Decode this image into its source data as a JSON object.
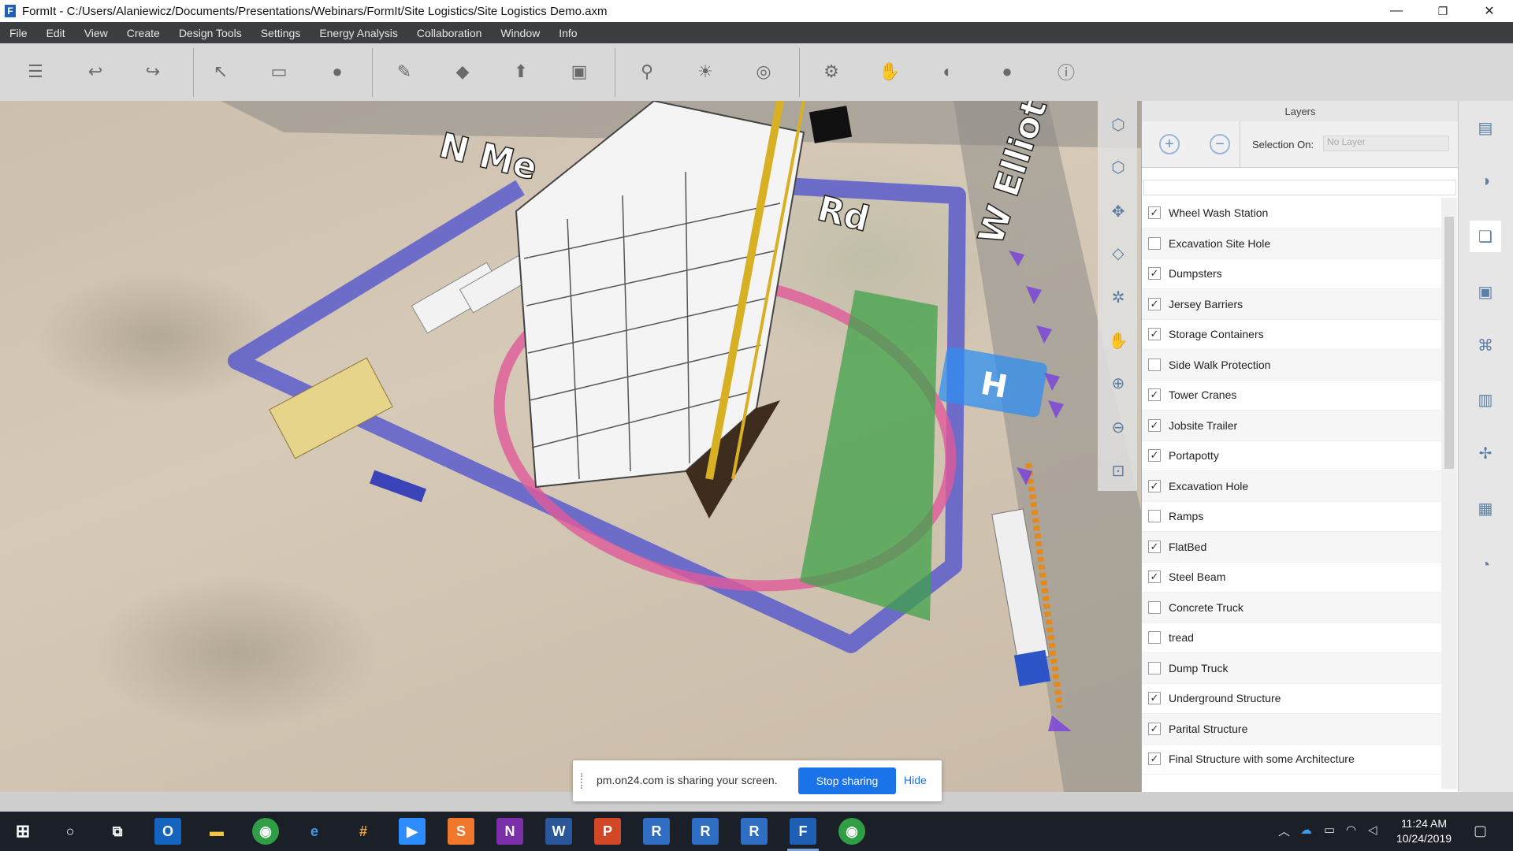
{
  "window": {
    "title": "FormIt - C:/Users/Alaniewicz/Documents/Presentations/Webinars/FormIt/Site Logistics/Site Logistics Demo.axm",
    "app_icon_letter": "F",
    "controls": {
      "minimize": "—",
      "restore": "❐",
      "close": "✕"
    }
  },
  "menu": [
    "File",
    "Edit",
    "View",
    "Create",
    "Design Tools",
    "Settings",
    "Energy Analysis",
    "Collaboration",
    "Window",
    "Info"
  ],
  "toolbar_icons": [
    "layers-menu-icon",
    "undo-icon",
    "redo-icon",
    "select-icon",
    "tape-measure-icon",
    "paint-icon",
    "pencil-icon",
    "cube-icon",
    "extrude-icon",
    "group-icon",
    "location-pin-icon",
    "sun-icon",
    "view-count-icon",
    "settings-gear-icon",
    "hand-icon",
    "share-icon",
    "user-icon",
    "info-icon"
  ],
  "viewport": {
    "road_labels": [
      "N Me",
      "Rd",
      "W Elliot Rd"
    ],
    "helipad_letter": "H"
  },
  "layers_panel": {
    "title": "Layers",
    "selection_label": "Selection On:",
    "selection_value": "No Layer",
    "add_symbol": "+",
    "remove_symbol": "−",
    "items": [
      {
        "name": "Wheel Wash Station",
        "checked": true
      },
      {
        "name": "Excavation Site Hole",
        "checked": false
      },
      {
        "name": "Dumpsters",
        "checked": true
      },
      {
        "name": "Jersey Barriers",
        "checked": true
      },
      {
        "name": "Storage Containers",
        "checked": true
      },
      {
        "name": "Side Walk Protection",
        "checked": false
      },
      {
        "name": "Tower Cranes",
        "checked": true
      },
      {
        "name": "Jobsite Trailer",
        "checked": true
      },
      {
        "name": "Portapotty",
        "checked": true
      },
      {
        "name": "Excavation Hole",
        "checked": true
      },
      {
        "name": "Ramps",
        "checked": false
      },
      {
        "name": "FlatBed",
        "checked": true
      },
      {
        "name": "Steel Beam",
        "checked": true
      },
      {
        "name": "Concrete Truck",
        "checked": false
      },
      {
        "name": "tread",
        "checked": false
      },
      {
        "name": "Dump Truck",
        "checked": false
      },
      {
        "name": "Underground Structure",
        "checked": true
      },
      {
        "name": "Parital Structure",
        "checked": true
      },
      {
        "name": "Final Structure with some Architecture",
        "checked": true
      }
    ]
  },
  "share_bar": {
    "text": "pm.on24.com is sharing your screen.",
    "stop_label": "Stop sharing",
    "hide_label": "Hide"
  },
  "taskbar": {
    "apps": [
      "start",
      "search",
      "task-view",
      "outlook",
      "file-explorer",
      "chrome",
      "edge",
      "slack",
      "zoom",
      "sublime",
      "onenote",
      "word",
      "powerpoint",
      "revit",
      "revit",
      "revit",
      "formit",
      "chrome"
    ],
    "time": "11:24 AM",
    "date": "10/24/2019"
  },
  "colors": {
    "menubar": "#3c3d40",
    "toolbar": "#d8d8d8",
    "accent": "#1a73e8",
    "fence_blue": "#4b4fd0",
    "green_zone": "#3fa24a",
    "pink_circle": "#e05a9a"
  }
}
